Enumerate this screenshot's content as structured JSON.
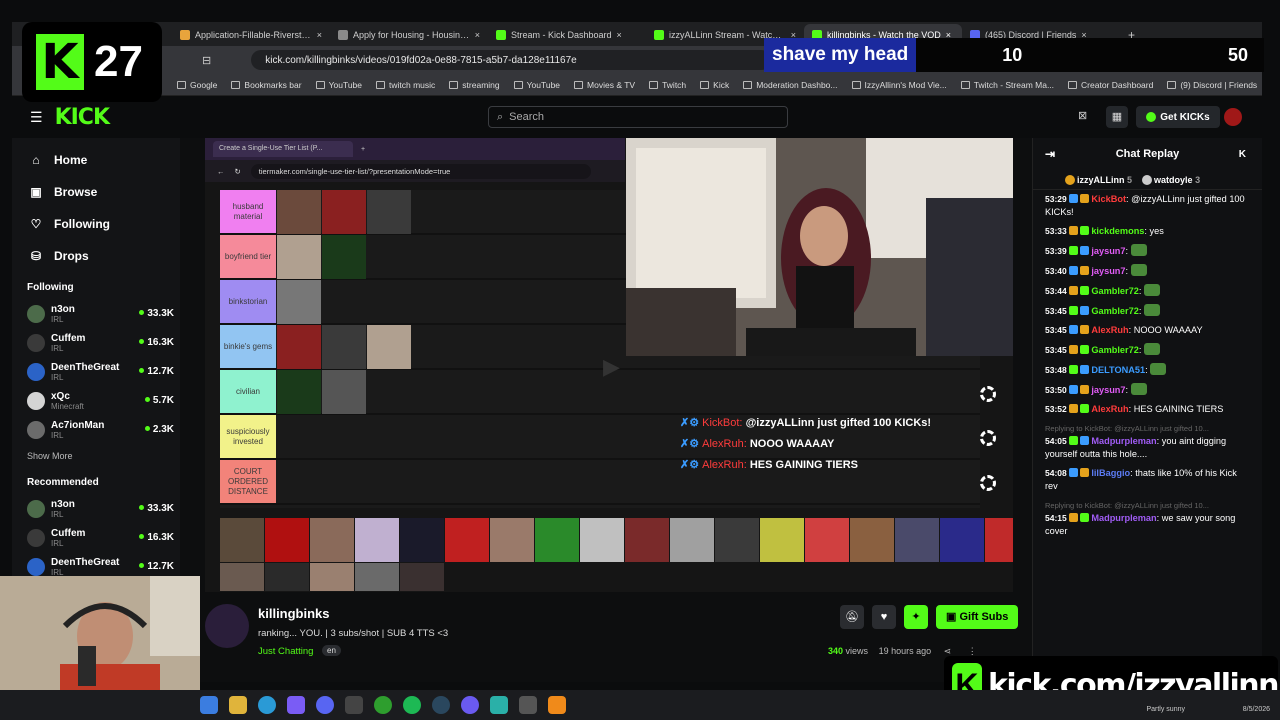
{
  "browser": {
    "tabs": [
      {
        "title": "Application-Fillable-Riverstone-Co",
        "icon": "folder-icon",
        "color": "#e8a43c"
      },
      {
        "title": "Apply for Housing - Housing Auth",
        "icon": "globe-icon",
        "color": "#8a8a8a"
      },
      {
        "title": "Stream - Kick Dashboard",
        "icon": "kick-icon",
        "color": "#53fc18"
      },
      {
        "title": "izzyALLinn Stream - Watch Live",
        "icon": "kick-icon",
        "color": "#53fc18"
      },
      {
        "title": "killingbinks - Watch the VOD",
        "icon": "kick-icon",
        "color": "#53fc18"
      },
      {
        "title": "(465) Discord | Friends",
        "icon": "discord-icon",
        "color": "#5865f2"
      }
    ],
    "url": "kick.com/killingbinks/videos/019fd02a-0e88-7815-a5b7-da128e11167e",
    "bookmarks": [
      "Google",
      "Bookmarks bar",
      "YouTube",
      "twitch music",
      "streaming",
      "YouTube",
      "Movies & TV",
      "Twitch",
      "Kick",
      "Moderation Dashbo...",
      "IzzyAllinn's Mod Vie...",
      "Twitch - Stream Ma...",
      "Creator Dashboard",
      "(9) Discord | Friends"
    ]
  },
  "overlay": {
    "badge_letter": "K",
    "badge_count": "27",
    "goal_label": "shave my head",
    "goal_current": "10",
    "goal_target": "50",
    "kick_url": "kick.com/izzyallinn"
  },
  "kick": {
    "logo": "KICK",
    "search_placeholder": "Search",
    "get_kicks": "Get KICKs",
    "nav": [
      {
        "label": "Home",
        "icon": "home-icon",
        "glyph": "⌂"
      },
      {
        "label": "Browse",
        "icon": "browse-icon",
        "glyph": "▣"
      },
      {
        "label": "Following",
        "icon": "heart-icon",
        "glyph": "♡"
      },
      {
        "label": "Drops",
        "icon": "drops-icon",
        "glyph": "⛁"
      }
    ],
    "following_title": "Following",
    "following": [
      {
        "name": "n3on",
        "cat": "IRL",
        "viewers": "33.3K"
      },
      {
        "name": "Cuffem",
        "cat": "IRL",
        "viewers": "16.3K"
      },
      {
        "name": "DeenTheGreat",
        "cat": "IRL",
        "viewers": "12.7K"
      },
      {
        "name": "xQc",
        "cat": "Minecraft",
        "viewers": "5.7K"
      },
      {
        "name": "Ac7ionMan",
        "cat": "IRL",
        "viewers": "2.3K"
      }
    ],
    "show_more": "Show More",
    "recommended_title": "Recommended",
    "recommended": [
      {
        "name": "n3on",
        "cat": "IRL",
        "viewers": "33.3K"
      },
      {
        "name": "Cuffem",
        "cat": "IRL",
        "viewers": "16.3K"
      },
      {
        "name": "DeenTheGreat",
        "cat": "IRL",
        "viewers": "12.7K"
      }
    ]
  },
  "stream": {
    "tiermaker_tab": "Create a Single-Use Tier List (P...",
    "tiermaker_url": "tiermaker.com/single-use-tier-list/?presentationMode=true",
    "tiers": [
      {
        "label": "husband material",
        "color": "#f07ff0"
      },
      {
        "label": "boyfriend tier",
        "color": "#f58a9a"
      },
      {
        "label": "binkstorian",
        "color": "#9f8cf2"
      },
      {
        "label": "binkie's gems",
        "color": "#92c5f2"
      },
      {
        "label": "civilian",
        "color": "#8ff2cf"
      },
      {
        "label": "suspiciously invested",
        "color": "#f2f28a"
      },
      {
        "label": "COURT ORDERED DISTANCE",
        "color": "#f2837a"
      }
    ],
    "overlay_chat": [
      {
        "user": "KickBot:",
        "text": "@izzyALLinn just gifted 100 KICKs!"
      },
      {
        "user": "AlexRuh:",
        "text": "NOOO WAAAAY"
      },
      {
        "user": "AlexRuh:",
        "text": "HES GAINING TIERS"
      }
    ],
    "channel": "killingbinks",
    "title": "ranking... YOU. | 3 subs/shot | SUB 4 TTS <3",
    "category": "Just Chatting",
    "language": "en",
    "views": "340",
    "views_label": "views",
    "age": "19 hours ago",
    "gift_subs": "Gift Subs"
  },
  "chat": {
    "title": "Chat Replay",
    "gifters": [
      {
        "name": "izzyALLinn",
        "count": "5"
      },
      {
        "name": "watdoyle",
        "count": "3"
      }
    ],
    "messages": [
      {
        "ts": "53:29",
        "user": "KickBot",
        "color": "#ff3c3c",
        "text": "@izzyALLinn just gifted 100 KICKs!",
        "reply": ""
      },
      {
        "ts": "53:33",
        "user": "kickdemons",
        "color": "#53fc18",
        "text": "yes",
        "reply": ""
      },
      {
        "ts": "53:39",
        "user": "jaysun7",
        "color": "#e05cf5",
        "text": "",
        "reply": ""
      },
      {
        "ts": "53:40",
        "user": "jaysun7",
        "color": "#e05cf5",
        "text": "",
        "reply": ""
      },
      {
        "ts": "53:44",
        "user": "Gambler72",
        "color": "#53fc18",
        "text": "",
        "reply": ""
      },
      {
        "ts": "53:45",
        "user": "Gambler72",
        "color": "#53fc18",
        "text": "",
        "reply": ""
      },
      {
        "ts": "53:45",
        "user": "AlexRuh",
        "color": "#ff3c3c",
        "text": "NOOO WAAAAY",
        "reply": ""
      },
      {
        "ts": "53:45",
        "user": "Gambler72",
        "color": "#53fc18",
        "text": "",
        "reply": ""
      },
      {
        "ts": "53:48",
        "user": "DELTONA51",
        "color": "#3b9cff",
        "text": "",
        "reply": ""
      },
      {
        "ts": "53:50",
        "user": "jaysun7",
        "color": "#e05cf5",
        "text": "",
        "reply": ""
      },
      {
        "ts": "53:52",
        "user": "AlexRuh",
        "color": "#ff3c3c",
        "text": "HES GAINING TIERS",
        "reply": ""
      },
      {
        "ts": "54:05",
        "user": "Madpurpleman",
        "color": "#a05cf5",
        "text": "you aint digging yourself outta this hole....",
        "reply": "Replying to KickBot: @izzyALLinn just gifted 10..."
      },
      {
        "ts": "54:08",
        "user": "lilBaggio",
        "color": "#5c7cf5",
        "text": "thats like 10% of his Kick rev",
        "reply": ""
      },
      {
        "ts": "54:15",
        "user": "Madpurpleman",
        "color": "#a05cf5",
        "text": "we saw your song cover",
        "reply": "Replying to KickBot: @izzyALLinn just gifted 10..."
      }
    ]
  },
  "taskbar": {
    "weather": "Partly sunny",
    "date": "8/5/2026"
  }
}
